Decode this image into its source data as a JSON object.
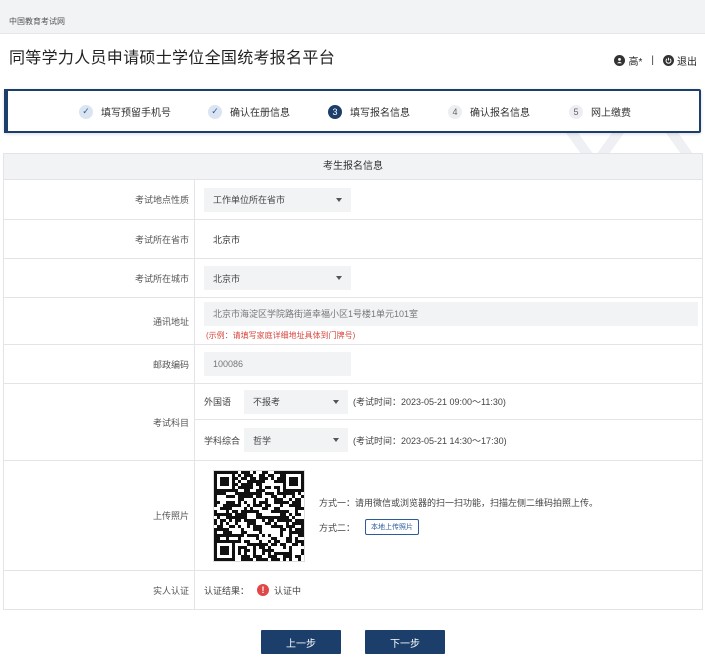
{
  "header": {
    "site_name": "中国教育考试网",
    "platform_title": "同等学力人员申请硕士学位全国统考报名平台",
    "user_name": "高*",
    "separator": "|",
    "logout_label": "退出"
  },
  "steps": [
    {
      "num": "✓",
      "label": "填写预留手机号",
      "state": "done"
    },
    {
      "num": "✓",
      "label": "确认在册信息",
      "state": "done"
    },
    {
      "num": "3",
      "label": "填写报名信息",
      "state": "active"
    },
    {
      "num": "4",
      "label": "确认报名信息",
      "state": "todo"
    },
    {
      "num": "5",
      "label": "网上缴费",
      "state": "todo"
    }
  ],
  "form": {
    "header": "考生报名信息",
    "exam_location_type": {
      "label": "考试地点性质",
      "value": "工作单位所在省市"
    },
    "exam_province": {
      "label": "考试所在省市",
      "value": "北京市"
    },
    "exam_city": {
      "label": "考试所在城市",
      "value": "北京市"
    },
    "address": {
      "label": "通讯地址",
      "value": "北京市海淀区学院路街道幸福小区1号楼1单元101室",
      "hint": "(示例：请填写家庭详细地址具体到门牌号)"
    },
    "postal_code": {
      "label": "邮政编码",
      "value": "100086"
    },
    "subjects": {
      "label": "考试科目",
      "foreign": {
        "label": "外国语",
        "value": "不报考",
        "time": "(考试时间：2023-05-21 09:00～11:30)"
      },
      "subject": {
        "label": "学科综合",
        "value": "哲学",
        "time": "(考试时间：2023-05-21 14:30～17:30)"
      }
    },
    "photo": {
      "label": "上传照片",
      "method1": "方式一：请用微信或浏览器的扫一扫功能，扫描左侧二维码拍照上传。",
      "method2": "方式二：",
      "upload_button": "本地上传照片"
    },
    "verify": {
      "label": "实人认证",
      "result_label": "认证结果：",
      "icon": "!",
      "status": "认证中"
    }
  },
  "buttons": {
    "prev": "上一步",
    "next": "下一步"
  }
}
